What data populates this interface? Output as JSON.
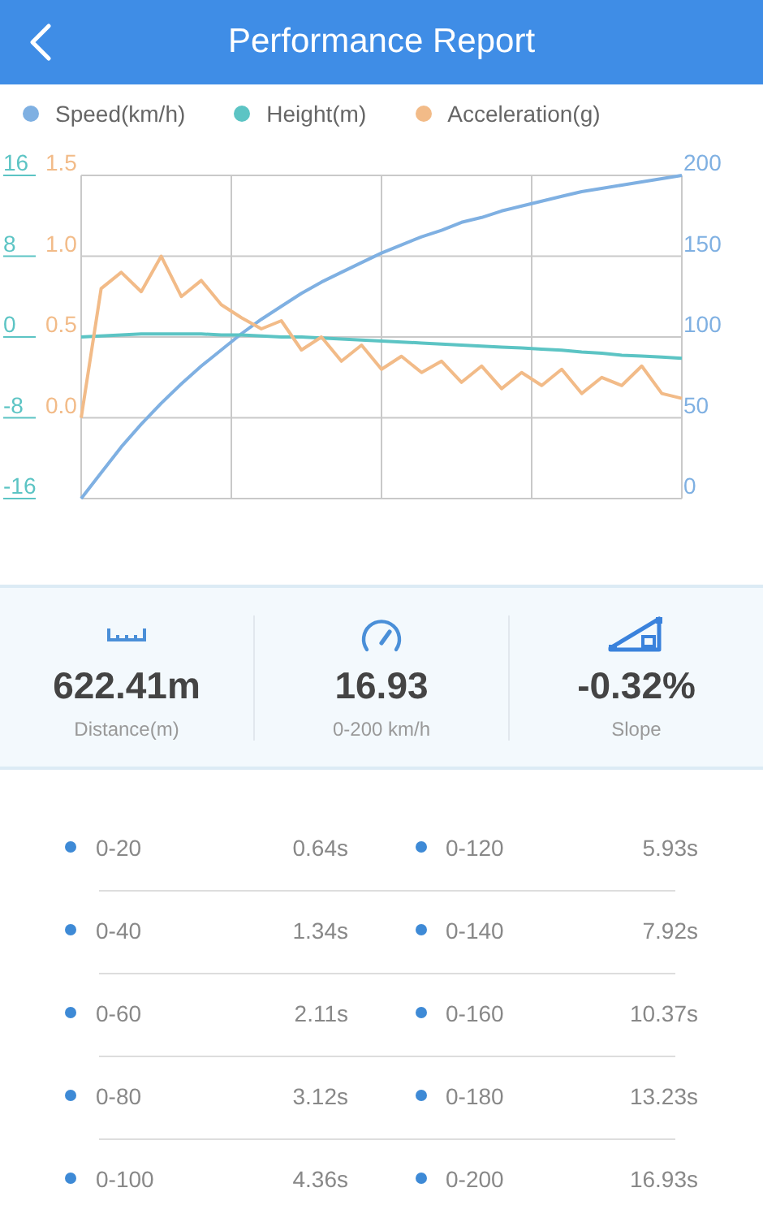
{
  "header": {
    "title": "Performance Report"
  },
  "chart_data": {
    "type": "line",
    "yticks": [
      {
        "value": 16,
        "label": "16"
      },
      {
        "value": 8,
        "label": "8"
      },
      {
        "value": 0,
        "label": "0"
      },
      {
        "value": -8,
        "label": "-8"
      },
      {
        "value": -16,
        "label": "-16"
      }
    ],
    "y2ticks": [
      {
        "value": 200,
        "label": "200"
      },
      {
        "value": 150,
        "label": "150"
      },
      {
        "value": 100,
        "label": "100"
      },
      {
        "value": 50,
        "label": "50"
      },
      {
        "value": 0,
        "label": "0"
      }
    ],
    "y3ticks": [
      {
        "value": 1.5,
        "label": "1.5"
      },
      {
        "value": 1.0,
        "label": "1.0"
      },
      {
        "value": 0.5,
        "label": "0.5"
      },
      {
        "value": 0.0,
        "label": "0.0"
      }
    ],
    "series": [
      {
        "name": "Speed(km/h)",
        "color": "#7fb0e2",
        "axis": "y2",
        "values": [
          0,
          16,
          32,
          46,
          59,
          71,
          82,
          92,
          102,
          111,
          119,
          127,
          134,
          140,
          146,
          152,
          157,
          162,
          166,
          171,
          174,
          178,
          181,
          184,
          187,
          190,
          192,
          194,
          196,
          198,
          200
        ]
      },
      {
        "name": "Height(m)",
        "color": "#5cc4c4",
        "values": [
          0,
          0.1,
          0.2,
          0.3,
          0.3,
          0.3,
          0.3,
          0.2,
          0.2,
          0.1,
          0,
          0,
          -0.1,
          -0.2,
          -0.3,
          -0.4,
          -0.5,
          -0.6,
          -0.7,
          -0.8,
          -0.9,
          -1.0,
          -1.1,
          -1.2,
          -1.3,
          -1.5,
          -1.6,
          -1.8,
          -1.9,
          -2.0,
          -2.1
        ]
      },
      {
        "name": "Acceleration(g)",
        "color": "#f2bb88",
        "axis": "y3",
        "values": [
          0.0,
          0.8,
          0.9,
          0.78,
          1.0,
          0.75,
          0.85,
          0.7,
          0.62,
          0.55,
          0.6,
          0.42,
          0.5,
          0.35,
          0.45,
          0.3,
          0.38,
          0.28,
          0.35,
          0.22,
          0.32,
          0.18,
          0.28,
          0.2,
          0.3,
          0.15,
          0.25,
          0.2,
          0.32,
          0.15,
          0.12
        ]
      }
    ],
    "ylim": [
      -16,
      16
    ],
    "y2lim": [
      0,
      200
    ],
    "y3lim": [
      -0.5,
      1.5
    ],
    "grid": true
  },
  "stats": [
    {
      "kind": "distance",
      "value": "622.41m",
      "label": "Distance(m)"
    },
    {
      "kind": "speed",
      "value": "16.93",
      "label": "0-200 km/h"
    },
    {
      "kind": "slope",
      "value": "-0.32%",
      "label": "Slope"
    }
  ],
  "splits": [
    {
      "range": "0-20",
      "time": "0.64s"
    },
    {
      "range": "0-120",
      "time": "5.93s"
    },
    {
      "range": "0-40",
      "time": "1.34s"
    },
    {
      "range": "0-140",
      "time": "7.92s"
    },
    {
      "range": "0-60",
      "time": "2.11s"
    },
    {
      "range": "0-160",
      "time": "10.37s"
    },
    {
      "range": "0-80",
      "time": "3.12s"
    },
    {
      "range": "0-180",
      "time": "13.23s"
    },
    {
      "range": "0-100",
      "time": "4.36s"
    },
    {
      "range": "0-200",
      "time": "16.93s"
    }
  ]
}
